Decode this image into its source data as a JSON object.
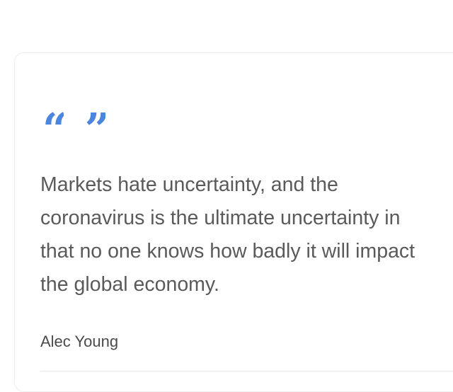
{
  "quote": {
    "open_mark": "“",
    "close_mark": "”",
    "text": "Markets hate uncertainty, and the coronavirus is the ultimate uncertainty in that no one knows how badly it will impact the global economy.",
    "author": "Alec Young"
  },
  "colors": {
    "accent": "#4a86e0",
    "text": "#5a5a5a",
    "author": "#4a4a4a"
  }
}
